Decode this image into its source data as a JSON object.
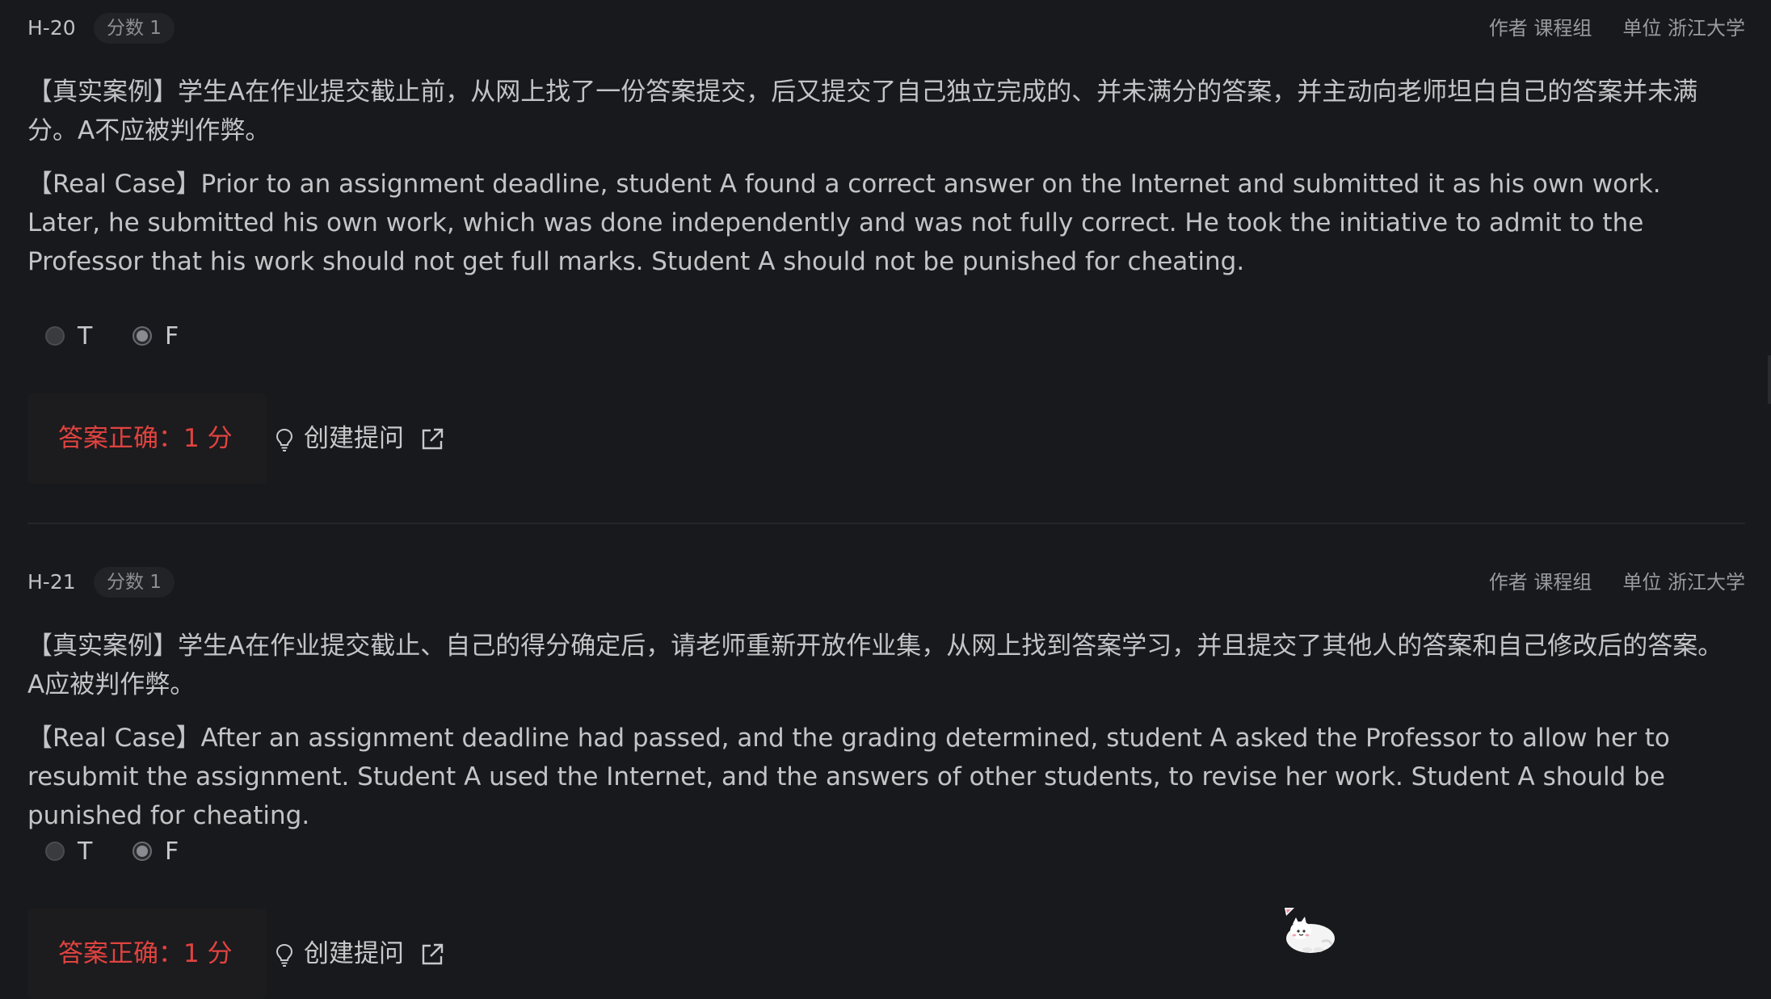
{
  "problems": [
    {
      "id": "H-20",
      "score_label": "分数 1",
      "author": "作者 课程组",
      "unit": "单位 浙江大学",
      "text_zh": "【真实案例】学生A在作业提交截止前，从网上找了一份答案提交，后又提交了自己独立完成的、并未满分的答案，并主动向老师坦白自己的答案并未满分。A不应被判作弊。",
      "text_en": "【Real Case】Prior to an assignment deadline, student A found a correct answer on the Internet and submitted it as his own work. Later, he submitted his own work, which was done independently and was not fully correct. He took the initiative to admit to the Professor that his work should not get full marks. Student A should not be punished for cheating.",
      "options": [
        {
          "label": "T",
          "selected": false
        },
        {
          "label": "F",
          "selected": true
        }
      ],
      "verdict": "答案正确：1 分",
      "ask_label": "创建提问"
    },
    {
      "id": "H-21",
      "score_label": "分数 1",
      "author": "作者 课程组",
      "unit": "单位 浙江大学",
      "text_zh": "【真实案例】学生A在作业提交截止、自己的得分确定后，请老师重新开放作业集，从网上找到答案学习，并且提交了其他人的答案和自己修改后的答案。A应被判作弊。",
      "text_en": "【Real Case】After an assignment deadline had passed, and the grading determined, student A asked the Professor to allow her to resubmit the assignment. Student A used the Internet, and the answers of other students, to revise her work. Student A should be punished for cheating.",
      "options": [
        {
          "label": "T",
          "selected": false
        },
        {
          "label": "F",
          "selected": true
        }
      ],
      "verdict": "答案正确：1 分",
      "ask_label": "创建提问"
    }
  ],
  "colors": {
    "background": "#18191c",
    "text": "#c4c4c7",
    "correct": "#e0433f",
    "muted": "#9a9b9e"
  },
  "icons": {
    "ask": "lightbulb-icon",
    "external": "external-link-icon",
    "mascot": "cat-mascot-icon"
  }
}
